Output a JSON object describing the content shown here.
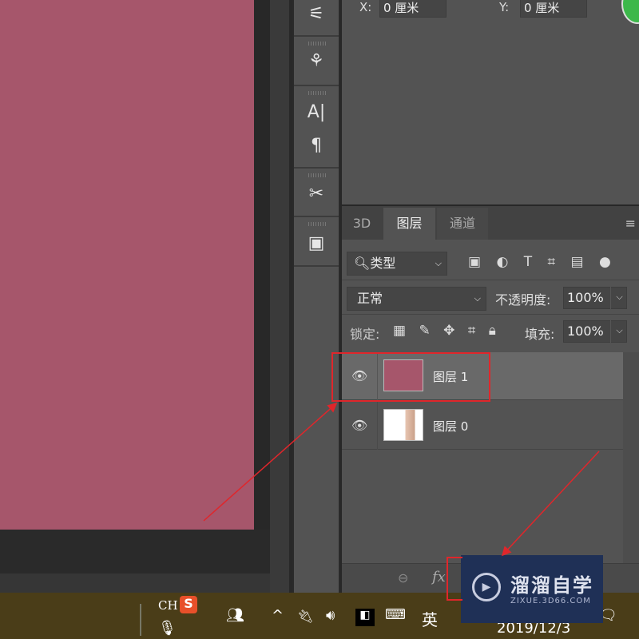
{
  "canvas": {
    "fill_color": "#a6566b"
  },
  "tools": {
    "icons": [
      "brush-settings-icon",
      "clone-source-icon",
      "character-icon",
      "paragraph-icon",
      "tools-icon",
      "libraries-icon"
    ],
    "character_glyph": "A|",
    "paragraph_glyph": "¶"
  },
  "properties": {
    "x_label": "X:",
    "x_value": "0 厘米",
    "y_label": "Y:",
    "y_value": "0 厘米"
  },
  "layers_panel": {
    "tabs": [
      {
        "label": "3D"
      },
      {
        "label": "图层",
        "active": true
      },
      {
        "label": "通道"
      }
    ],
    "filter_kind": "类型",
    "blend_mode": "正常",
    "opacity_label": "不透明度:",
    "opacity_value": "100%",
    "lock_label": "锁定:",
    "fill_label": "填充:",
    "fill_value": "100%",
    "layers": [
      {
        "name": "图层 1",
        "selected": true,
        "thumb_color": "#a6566b"
      },
      {
        "name": "图层 0",
        "selected": false
      }
    ],
    "bottom": {
      "link": "⊖",
      "fx": "fx"
    }
  },
  "taskbar": {
    "lang": "CH",
    "ime_logo": "S",
    "ime_mode": "英",
    "date": "2019/12/3"
  },
  "watermark": {
    "brand": "溜溜自学",
    "url": "ZIXUE.3D66.COM"
  },
  "annotation_color": "#e0262b"
}
